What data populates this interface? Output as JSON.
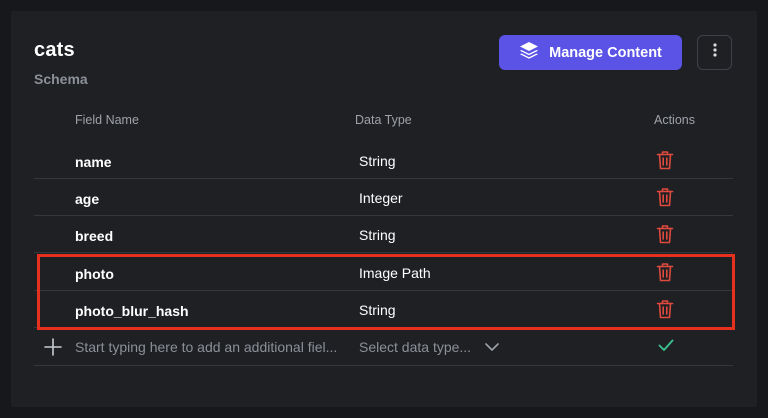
{
  "collection": {
    "name": "cats",
    "subtitle": "Schema"
  },
  "toolbar": {
    "manage_label": "Manage Content",
    "manage_icon": "stack-layers-icon",
    "more_icon": "vertical-ellipsis-icon"
  },
  "table": {
    "headers": {
      "field_name": "Field Name",
      "data_type": "Data Type",
      "actions": "Actions"
    },
    "rows": [
      {
        "field": "name",
        "type": "String"
      },
      {
        "field": "age",
        "type": "Integer"
      },
      {
        "field": "breed",
        "type": "String"
      },
      {
        "field": "photo",
        "type": "Image Path"
      },
      {
        "field": "photo_blur_hash",
        "type": "String"
      }
    ],
    "add_row": {
      "input_placeholder": "Start typing here to add an additional fiel...",
      "select_placeholder": "Select data type...",
      "confirm_icon": "check-icon",
      "add_icon": "plus-icon"
    }
  },
  "colors": {
    "accent": "#5b53e6",
    "delete": "#e04a3c",
    "confirm": "#3bbf8f",
    "highlight": "#e8301f"
  }
}
